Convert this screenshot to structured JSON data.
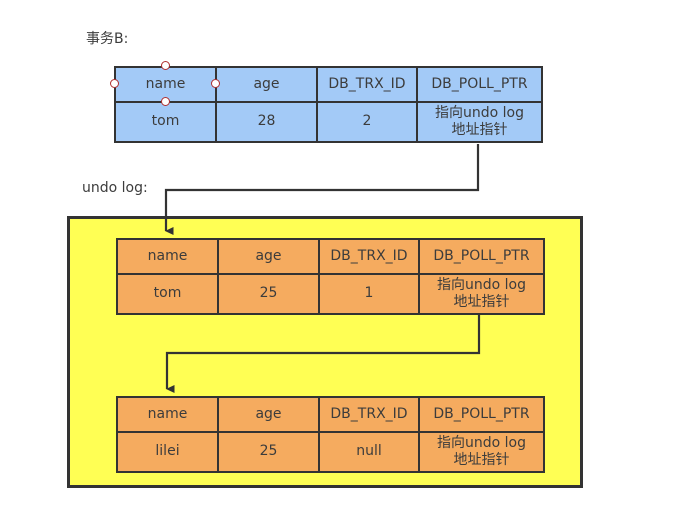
{
  "labels": {
    "transaction": "事务B:",
    "undo_log": "undo log:"
  },
  "colors": {
    "current_row_fill": "#a3caf7",
    "undo_row_fill": "#f5ab5f",
    "undo_container_fill": "#ffff54",
    "border": "#333333",
    "handle_stroke": "#b03030"
  },
  "columns": [
    "name",
    "age",
    "DB_TRX_ID",
    "DB_POLL_PTR"
  ],
  "pointer_text": {
    "line1": "指向undo log",
    "line2": "地址指针"
  },
  "tables": {
    "current": {
      "headers": [
        "name",
        "age",
        "DB_TRX_ID",
        "DB_POLL_PTR"
      ],
      "values": [
        "tom",
        "28",
        "2"
      ],
      "pointer_line1": "指向undo log",
      "pointer_line2": "地址指针"
    },
    "undo_1": {
      "headers": [
        "name",
        "age",
        "DB_TRX_ID",
        "DB_POLL_PTR"
      ],
      "values": [
        "tom",
        "25",
        "1"
      ],
      "pointer_line1": "指向undo log",
      "pointer_line2": "地址指针"
    },
    "undo_2": {
      "headers": [
        "name",
        "age",
        "DB_TRX_ID",
        "DB_POLL_PTR"
      ],
      "values": [
        "lilei",
        "25",
        "null"
      ],
      "pointer_line1": "指向undo log",
      "pointer_line2": "地址指针"
    }
  }
}
